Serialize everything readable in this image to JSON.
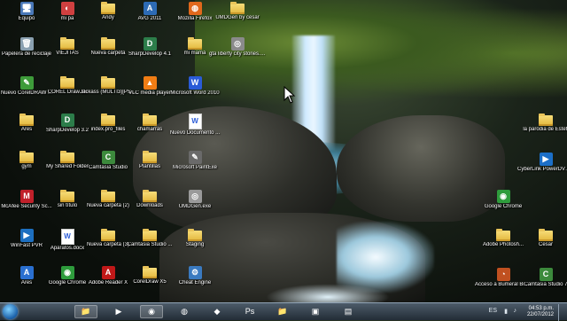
{
  "desktop": {
    "icons": [
      {
        "label": "Equipo",
        "glyph": "🖥",
        "kind": "app",
        "color": "#4a78b8"
      },
      {
        "label": "Papelera de reciclaje",
        "glyph": "🗑",
        "kind": "app",
        "color": "#8aa0b0"
      },
      {
        "label": "Nuevo CorelDRAW ...",
        "glyph": "✎",
        "kind": "app",
        "color": "#3e9b3a"
      },
      {
        "label": "Ares",
        "glyph": "",
        "kind": "folder",
        "color": ""
      },
      {
        "label": "gym",
        "glyph": "",
        "kind": "folder",
        "color": ""
      },
      {
        "label": "McAfee Security Sc...",
        "glyph": "M",
        "kind": "app",
        "color": "#c0202a"
      },
      {
        "label": "WinFast PVR",
        "glyph": "▶",
        "kind": "app",
        "color": "#1d6fc0"
      },
      {
        "label": "Ares",
        "glyph": "A",
        "kind": "app",
        "color": "#2a6fd0"
      },
      {
        "label": "mi pa",
        "glyph": "◐",
        "kind": "app",
        "color": "#d04040"
      },
      {
        "label": "VIEJITAS",
        "glyph": "",
        "kind": "folder",
        "color": ""
      },
      {
        "label": "COREL Draw 15",
        "glyph": "",
        "kind": "folder",
        "color": ""
      },
      {
        "label": "SharpDevelop 3.2",
        "glyph": "D",
        "kind": "app",
        "color": "#2c7d4a"
      },
      {
        "label": "My Shared Folder",
        "glyph": "",
        "kind": "folder",
        "color": ""
      },
      {
        "label": "sin título",
        "glyph": "",
        "kind": "folder",
        "color": ""
      },
      {
        "label": "Aparatos.docx",
        "glyph": "W",
        "kind": "doc",
        "color": "#2a5bd7"
      },
      {
        "label": "Google Chrome",
        "glyph": "◉",
        "kind": "app",
        "color": "#2e9c3c"
      },
      {
        "label": "Andy",
        "glyph": "",
        "kind": "folder",
        "color": ""
      },
      {
        "label": "Nueva carpeta",
        "glyph": "",
        "kind": "folder",
        "color": ""
      },
      {
        "label": "Jackass (MULTI3)[PSP]...",
        "glyph": "",
        "kind": "folder",
        "color": ""
      },
      {
        "label": "index.pro_files",
        "glyph": "",
        "kind": "folder",
        "color": ""
      },
      {
        "label": "Camtasia Studio",
        "glyph": "C",
        "kind": "app",
        "color": "#3c8a3c"
      },
      {
        "label": "Nueva carpeta (2)",
        "glyph": "",
        "kind": "folder",
        "color": ""
      },
      {
        "label": "Nueva carpeta (3)",
        "glyph": "",
        "kind": "folder",
        "color": ""
      },
      {
        "label": "Adobe Reader X",
        "glyph": "A",
        "kind": "app",
        "color": "#c01818"
      },
      {
        "label": "AVG 2011",
        "glyph": "A",
        "kind": "app",
        "color": "#2d6bb5"
      },
      {
        "label": "SharpDevelop 4.1",
        "glyph": "D",
        "kind": "app",
        "color": "#2c7d4a"
      },
      {
        "label": "VLC media player",
        "glyph": "▲",
        "kind": "app",
        "color": "#f07d14"
      },
      {
        "label": "chamarras",
        "glyph": "",
        "kind": "folder",
        "color": ""
      },
      {
        "label": "Plantillas",
        "glyph": "",
        "kind": "folder",
        "color": ""
      },
      {
        "label": "Downloads",
        "glyph": "",
        "kind": "folder",
        "color": ""
      },
      {
        "label": "Camtasia Studio ...",
        "glyph": "",
        "kind": "folder",
        "color": ""
      },
      {
        "label": "CorelDraw X5",
        "glyph": "",
        "kind": "folder",
        "color": ""
      },
      {
        "label": "Mozilla Firefox",
        "glyph": "◍",
        "kind": "app",
        "color": "#e0681c"
      },
      {
        "label": "mi mamá",
        "glyph": "",
        "kind": "folder",
        "color": ""
      },
      {
        "label": "Microsoft Word 2010",
        "glyph": "W",
        "kind": "app",
        "color": "#2a5bd7"
      },
      {
        "label": "Nuevo Documento ...",
        "glyph": "W",
        "kind": "doc",
        "color": "#2a5bd7"
      },
      {
        "label": "Microsoft PaintExe",
        "glyph": "✎",
        "kind": "app",
        "color": "#6a6a6a"
      },
      {
        "label": "UMDGen.exe",
        "glyph": "◎",
        "kind": "app",
        "color": "#9a9a9a"
      },
      {
        "label": "Staging",
        "glyph": "",
        "kind": "folder",
        "color": ""
      },
      {
        "label": "Cheat Engine",
        "glyph": "⚙",
        "kind": "app",
        "color": "#3a7ac0"
      },
      {
        "label": "UMDGen by cesar",
        "glyph": "",
        "kind": "folder",
        "color": ""
      },
      {
        "label": "gta liberty city stories.iso",
        "glyph": "◎",
        "kind": "app",
        "color": "#8a8a8a"
      },
      {
        "label": "la parodia de Estefi",
        "glyph": "",
        "kind": "folder",
        "color": ""
      },
      {
        "label": "CyberLink PowerDVD 10",
        "glyph": "▶",
        "kind": "app",
        "color": "#1c6fc8"
      },
      {
        "label": "Google Chrome",
        "glyph": "◉",
        "kind": "app",
        "color": "#2e9c3c"
      },
      {
        "label": "Cesar",
        "glyph": "",
        "kind": "folder",
        "color": ""
      },
      {
        "label": "Camtasia Studio 7",
        "glyph": "C",
        "kind": "app",
        "color": "#3c8a3c"
      },
      {
        "label": "Adobe Photosh...",
        "glyph": "",
        "kind": "folder",
        "color": ""
      },
      {
        "label": "Acceso a Bumeral Bioscan...",
        "glyph": "◔",
        "kind": "app",
        "color": "#c05020"
      }
    ]
  },
  "taskbar": {
    "items": [
      {
        "name": "tb-explorer",
        "glyph": "📁",
        "active": true
      },
      {
        "name": "tb-media",
        "glyph": "▶",
        "active": false
      },
      {
        "name": "tb-chrome",
        "glyph": "◉",
        "active": true
      },
      {
        "name": "tb-firefox",
        "glyph": "◍",
        "active": false
      },
      {
        "name": "tb-mcafee",
        "glyph": "◆",
        "active": false
      },
      {
        "name": "tb-photoshop",
        "glyph": "Ps",
        "active": false
      },
      {
        "name": "tb-explorer2",
        "glyph": "📁",
        "active": false
      },
      {
        "name": "tb-app8",
        "glyph": "▣",
        "active": false
      },
      {
        "name": "tb-app9",
        "glyph": "▤",
        "active": false
      }
    ],
    "clock_time": "04:53 p.m.",
    "clock_date": "22/07/2012",
    "lang": "ES"
  }
}
